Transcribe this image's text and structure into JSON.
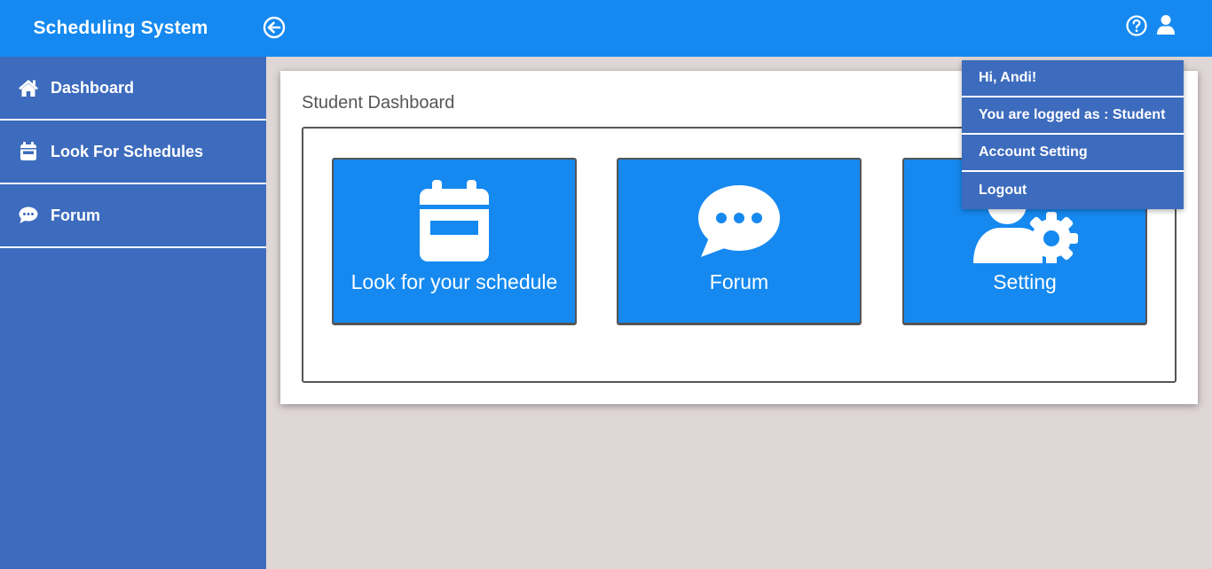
{
  "header": {
    "brand": "Scheduling System"
  },
  "sidebar": {
    "items": [
      {
        "label": "Dashboard",
        "icon": "home-icon"
      },
      {
        "label": "Look For Schedules",
        "icon": "calendar-icon"
      },
      {
        "label": "Forum",
        "icon": "chat-icon"
      }
    ]
  },
  "main": {
    "title": "Student Dashboard",
    "tiles": [
      {
        "label": "Look for your schedule",
        "icon": "calendar-icon"
      },
      {
        "label": "Forum",
        "icon": "chat-bubble-icon"
      },
      {
        "label": "Setting",
        "icon": "user-gear-icon"
      }
    ]
  },
  "user_menu": {
    "greeting": "Hi, Andi!",
    "role": "You are logged as : Student",
    "account_setting": "Account Setting",
    "logout": "Logout"
  },
  "colors": {
    "topbar": "#1589f0",
    "sidebar": "#3d6bbd",
    "background": "#dfd6d6"
  }
}
